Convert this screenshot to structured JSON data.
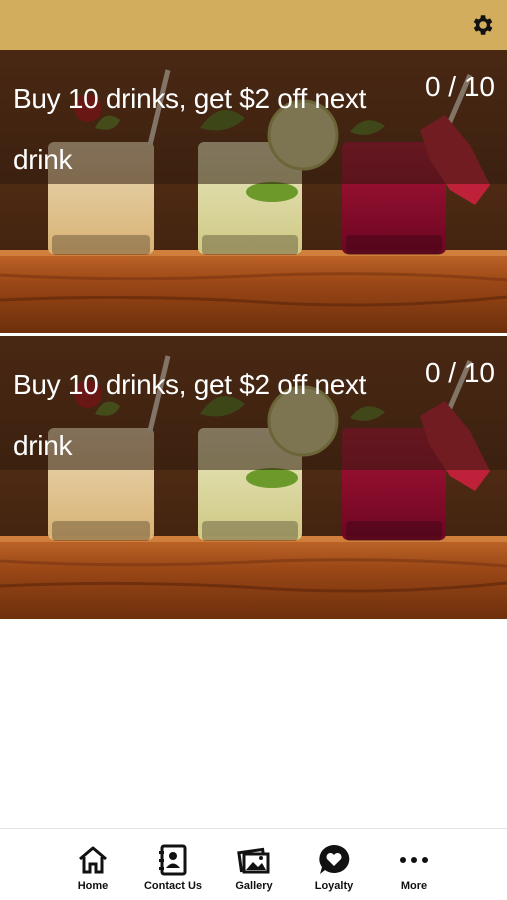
{
  "colors": {
    "header": "#d2ad5e",
    "overlay": "rgba(45,25,12,0.55)"
  },
  "header": {
    "settings_icon": "gear-icon"
  },
  "cards": [
    {
      "title": "Buy 10 drinks, get $2 off next drink",
      "progress": "0 / 10"
    },
    {
      "title": "Buy 10 drinks, get $2 off next drink",
      "progress": "0 / 10"
    }
  ],
  "tabs": [
    {
      "label": "Home",
      "icon": "home-icon"
    },
    {
      "label": "Contact Us",
      "icon": "contact-card-icon"
    },
    {
      "label": "Gallery",
      "icon": "gallery-icon"
    },
    {
      "label": "Loyalty",
      "icon": "heart-bubble-icon"
    },
    {
      "label": "More",
      "icon": "more-dots-icon"
    }
  ]
}
